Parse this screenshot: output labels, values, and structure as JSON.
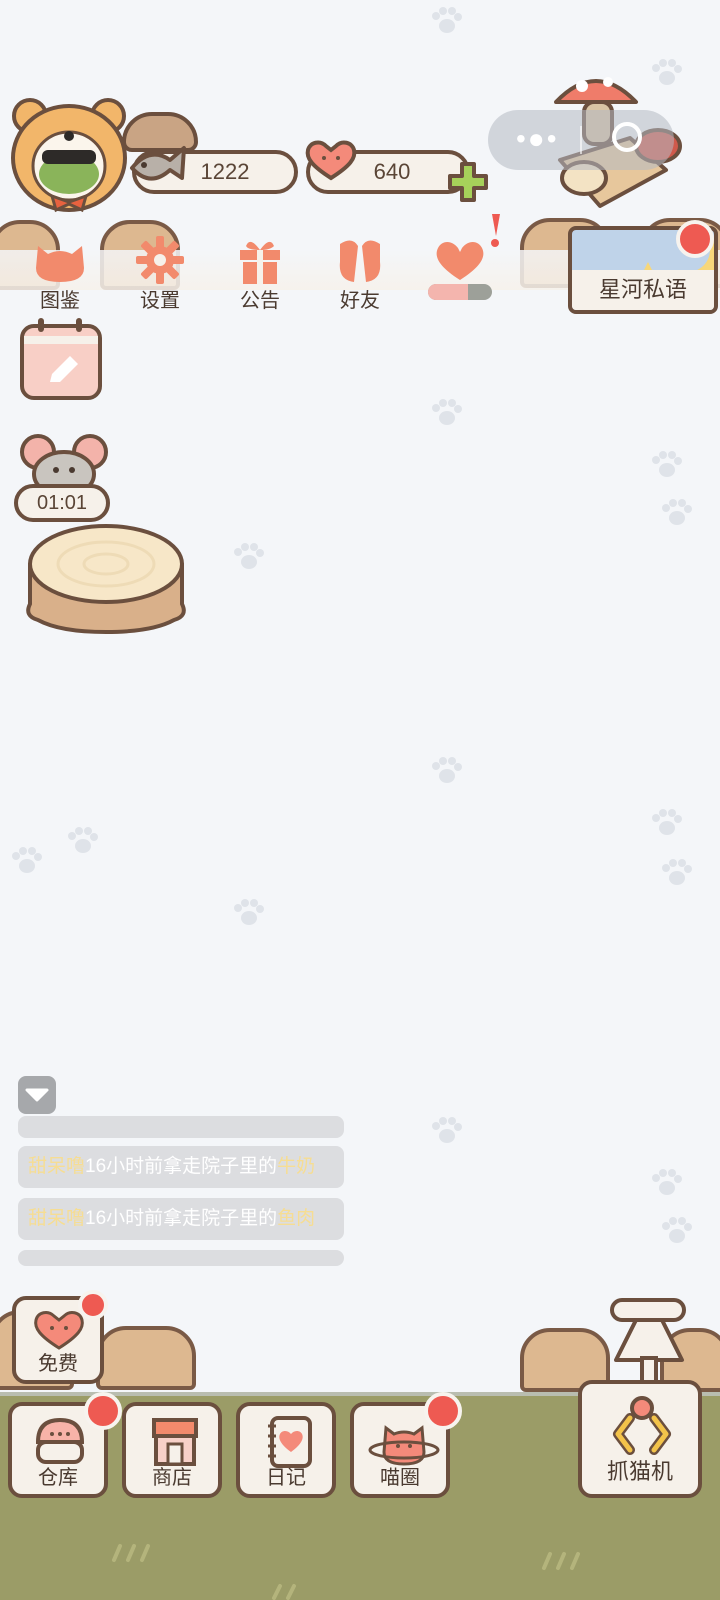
{
  "currency": {
    "fish": "1222",
    "hearts": "640"
  },
  "top_menu": [
    {
      "id": "collection",
      "label": "图鉴",
      "icon": "cat-head-icon"
    },
    {
      "id": "settings",
      "label": "设置",
      "icon": "gear-icon"
    },
    {
      "id": "notice",
      "label": "公告",
      "icon": "gift-icon"
    },
    {
      "id": "friends",
      "label": "好友",
      "icon": "friends-icon"
    },
    {
      "id": "love",
      "label": "",
      "icon": "heart-paw-icon"
    }
  ],
  "banner": {
    "label": "星河私语"
  },
  "mouse_timer": "01:01",
  "feed": [
    {
      "name": "甜呆噜",
      "text": "16小时前拿走院子里的",
      "item": "牛奶"
    },
    {
      "name": "甜呆噜",
      "text": "16小时前拿走院子里的",
      "item": "鱼肉"
    }
  ],
  "bottom": {
    "free": "免费",
    "warehouse": "仓库",
    "shop": "商店",
    "diary": "日记",
    "circle": "喵圈",
    "claw": "抓猫机"
  },
  "colors": {
    "accent": "#f08a6c",
    "brown": "#6b4f3e",
    "grass": "#9b9c67",
    "badge": "#ee5a52"
  }
}
